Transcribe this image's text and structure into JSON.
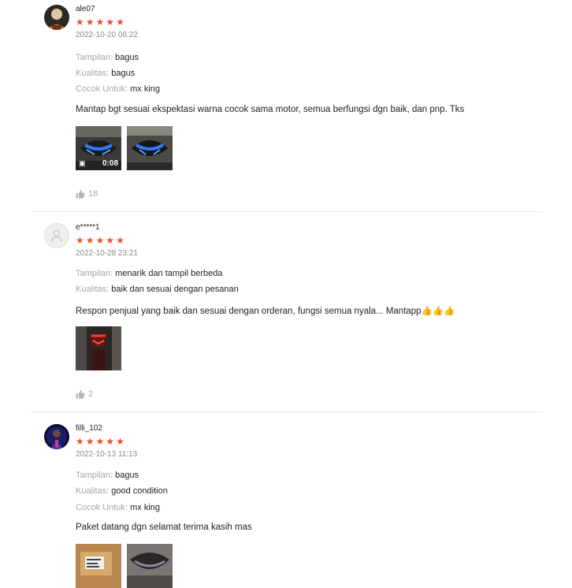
{
  "reviews": [
    {
      "username": "ale07",
      "rating": 5,
      "datetime": "2022-10-20 06:22",
      "attributes": [
        {
          "key": "Tampilan:",
          "value": "bagus"
        },
        {
          "key": "Kualitas:",
          "value": "bagus"
        },
        {
          "key": "Cocok Untuk:",
          "value": "mx king"
        }
      ],
      "comment": "Mantap bgt sesuai ekspektasi warna cocok sama motor, semua berfungsi dgn baik, dan pnp. Tks",
      "video_duration": "0:08",
      "likes": "18"
    },
    {
      "username": "e*****1",
      "rating": 5,
      "datetime": "2022-10-28 23:21",
      "attributes": [
        {
          "key": "Tampilan:",
          "value": "menarik dan tampil berbeda"
        },
        {
          "key": "Kualitas:",
          "value": "baik dan sesuai dengan pesanan"
        }
      ],
      "comment": "Respon penjual yang baik dan sesuai dengan orderan, fungsi semua nyala... Mantapp👍👍👍",
      "likes": "2"
    },
    {
      "username": "filli_102",
      "rating": 5,
      "datetime": "2022-10-13 11:13",
      "attributes": [
        {
          "key": "Tampilan:",
          "value": "bagus"
        },
        {
          "key": "Kualitas:",
          "value": "good condition"
        },
        {
          "key": "Cocok Untuk:",
          "value": "mx king"
        }
      ],
      "comment": "Paket datang dgn selamat terima kasih mas"
    }
  ],
  "colors": {
    "star": "#ee4d2d",
    "muted": "#a6a6a6",
    "divider": "#e8e8e8"
  }
}
